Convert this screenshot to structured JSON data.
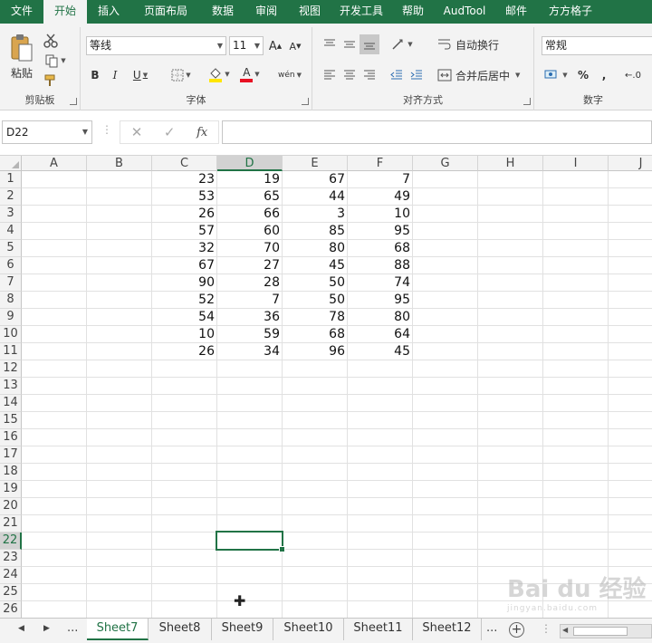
{
  "menu": {
    "tabs": [
      "文件",
      "开始",
      "插入",
      "页面布局",
      "数据",
      "审阅",
      "视图",
      "开发工具",
      "帮助",
      "AudTool",
      "邮件",
      "方方格子"
    ],
    "active": "开始"
  },
  "ribbon": {
    "clipboard": {
      "paste_label": "粘贴",
      "group_label": "剪贴板"
    },
    "font": {
      "font_name": "等线",
      "font_size": "11",
      "bold": "B",
      "italic": "I",
      "underline": "U",
      "grow": "A",
      "shrink": "A",
      "font_color": "A",
      "phonetic": "wén",
      "group_label": "字体"
    },
    "alignment": {
      "wrap_text": "自动换行",
      "merge_center": "合并后居中",
      "group_label": "对齐方式"
    },
    "number": {
      "format": "常规",
      "percent": "%",
      "comma": ",",
      "group_label": "数字"
    }
  },
  "formula_bar": {
    "name_box": "D22",
    "cancel": "✕",
    "enter": "✓",
    "fx": "fx",
    "value": ""
  },
  "grid": {
    "columns": [
      "A",
      "B",
      "C",
      "D",
      "E",
      "F",
      "G",
      "H",
      "I",
      "J"
    ],
    "rows": [
      "1",
      "2",
      "3",
      "4",
      "5",
      "6",
      "7",
      "8",
      "9",
      "10",
      "11",
      "12",
      "13",
      "14",
      "15",
      "16",
      "17",
      "18",
      "19",
      "20",
      "21",
      "22",
      "23",
      "24",
      "25",
      "26"
    ],
    "selected_column": "D",
    "selected_row": "22",
    "data": [
      [
        "23",
        "19",
        "67",
        "7"
      ],
      [
        "53",
        "65",
        "44",
        "49"
      ],
      [
        "26",
        "66",
        "3",
        "10"
      ],
      [
        "57",
        "60",
        "85",
        "95"
      ],
      [
        "32",
        "70",
        "80",
        "68"
      ],
      [
        "67",
        "27",
        "45",
        "88"
      ],
      [
        "90",
        "28",
        "50",
        "74"
      ],
      [
        "52",
        "7",
        "50",
        "95"
      ],
      [
        "54",
        "36",
        "78",
        "80"
      ],
      [
        "10",
        "59",
        "68",
        "64"
      ],
      [
        "26",
        "34",
        "96",
        "45"
      ]
    ]
  },
  "sheets": {
    "tabs": [
      "Sheet7",
      "Sheet8",
      "Sheet9",
      "Sheet10",
      "Sheet11",
      "Sheet12"
    ],
    "active": "Sheet7",
    "more_left": "...",
    "more_right": "...",
    "add": "+"
  },
  "watermark": {
    "brand": "Bai du 经验",
    "sub": "jingyan.baidu.com"
  },
  "colors": {
    "accent": "#217346",
    "ribbon_bg": "#f3f3f3"
  }
}
